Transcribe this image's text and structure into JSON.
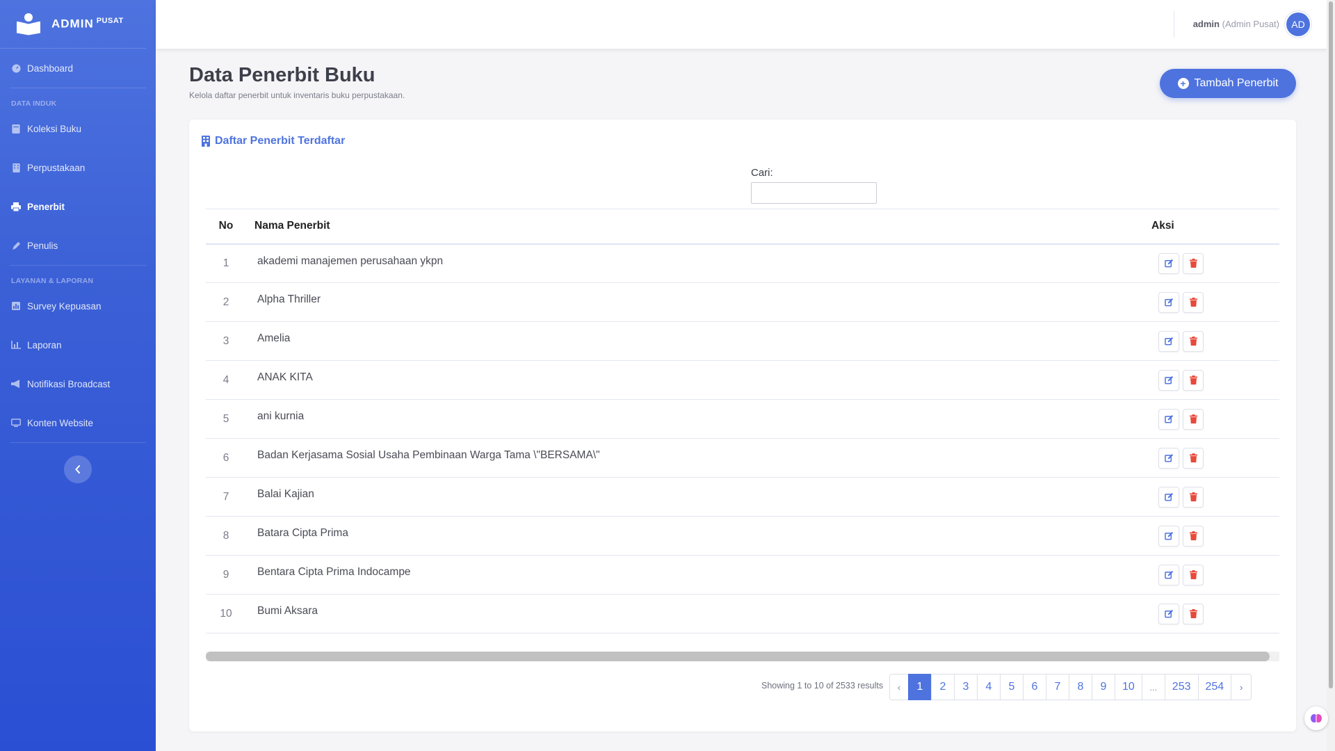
{
  "brand": {
    "name": "ADMIN",
    "suffix": "PUSAT"
  },
  "sidebar": {
    "items": [
      {
        "label": "Dashboard",
        "icon": "dashboard-icon"
      },
      {
        "label": "Koleksi Buku",
        "icon": "book-icon"
      },
      {
        "label": "Perpustakaan",
        "icon": "building-icon"
      },
      {
        "label": "Penerbit",
        "icon": "print-icon",
        "active": true
      },
      {
        "label": "Penulis",
        "icon": "pen-icon"
      },
      {
        "label": "Survey Kepuasan",
        "icon": "poll-icon"
      },
      {
        "label": "Laporan",
        "icon": "chart-icon"
      },
      {
        "label": "Notifikasi Broadcast",
        "icon": "megaphone-icon"
      },
      {
        "label": "Konten Website",
        "icon": "screen-icon"
      }
    ],
    "headings": [
      "DATA INDUK",
      "LAYANAN & LAPORAN"
    ]
  },
  "topbar": {
    "user_name": "admin",
    "user_role": "(Admin Pusat)",
    "avatar_text": "AD"
  },
  "page": {
    "title": "Data Penerbit Buku",
    "subtitle": "Kelola daftar penerbit untuk inventaris buku perpustakaan.",
    "add_button": "Tambah Penerbit"
  },
  "card": {
    "title": "Daftar Penerbit Terdaftar",
    "search_label": "Cari:",
    "search_value": ""
  },
  "table": {
    "headers": {
      "no": "No",
      "name": "Nama Penerbit",
      "action": "Aksi"
    },
    "rows": [
      {
        "no": "1",
        "name": "akademi manajemen perusahaan ykpn"
      },
      {
        "no": "2",
        "name": "Alpha Thriller"
      },
      {
        "no": "3",
        "name": "Amelia"
      },
      {
        "no": "4",
        "name": "ANAK KITA"
      },
      {
        "no": "5",
        "name": "ani kurnia"
      },
      {
        "no": "6",
        "name": "Badan Kerjasama Sosial Usaha Pembinaan Warga Tama \\\"BERSAMA\\\""
      },
      {
        "no": "7",
        "name": "Balai Kajian"
      },
      {
        "no": "8",
        "name": "Batara Cipta Prima"
      },
      {
        "no": "9",
        "name": "Bentara Cipta Prima Indocampe"
      },
      {
        "no": "10",
        "name": "Bumi Aksara"
      }
    ]
  },
  "pagination": {
    "showing": "Showing 1 to 10 of 2533 results",
    "prev": "‹",
    "next": "›",
    "pages": [
      "1",
      "2",
      "3",
      "4",
      "5",
      "6",
      "7",
      "8",
      "9",
      "10",
      "...",
      "253",
      "254"
    ],
    "current": "1"
  },
  "colors": {
    "primary": "#4e73df",
    "danger": "#e74a3b",
    "sidebar_dark": "#2b4fd3"
  }
}
